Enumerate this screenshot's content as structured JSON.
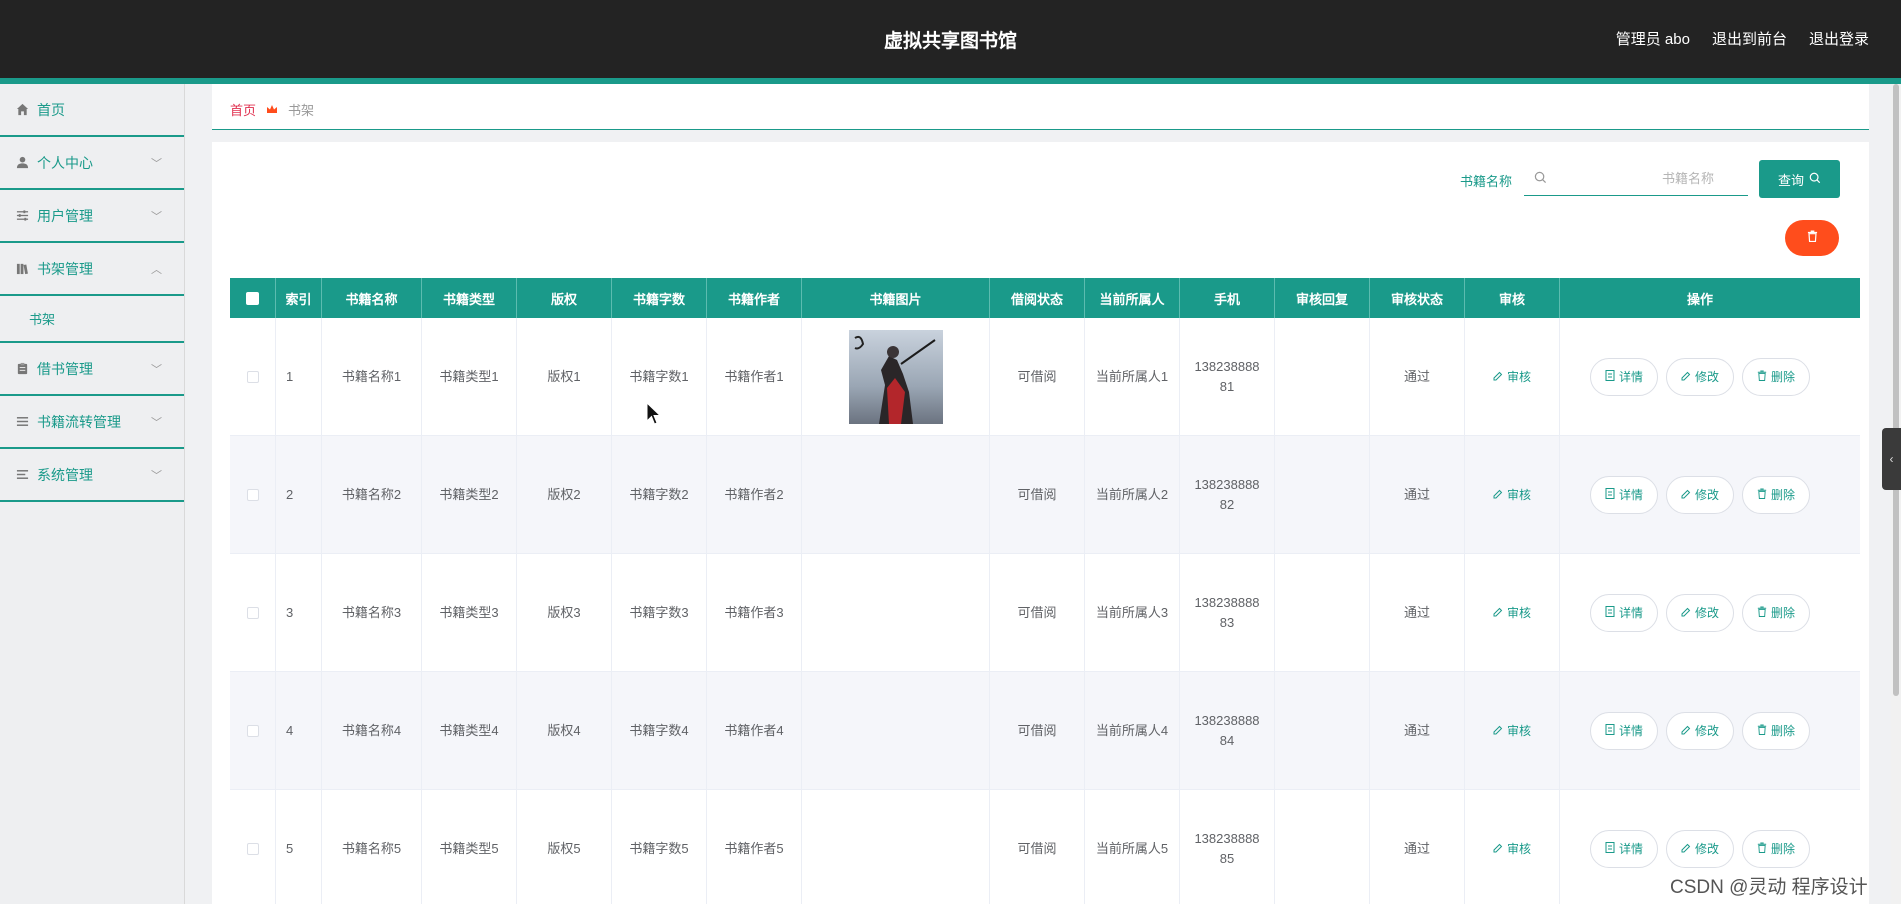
{
  "app": {
    "title": "虚拟共享图书馆",
    "user_label": "管理员 abo",
    "back_to_front": "退出到前台",
    "logout": "退出登录"
  },
  "sidebar": {
    "items": [
      {
        "label": "首页",
        "icon": "home-icon"
      },
      {
        "label": "个人中心",
        "icon": "user-icon"
      },
      {
        "label": "用户管理",
        "icon": "sliders-icon"
      },
      {
        "label": "书架管理",
        "icon": "books-icon"
      },
      {
        "label": "书架",
        "icon": ""
      },
      {
        "label": "借书管理",
        "icon": "clipboard-icon"
      },
      {
        "label": "书籍流转管理",
        "icon": "list-icon"
      },
      {
        "label": "系统管理",
        "icon": "menu-icon"
      }
    ]
  },
  "breadcrumb": {
    "home": "首页",
    "current": "书架"
  },
  "search": {
    "label": "书籍名称",
    "placeholder": "书籍名称",
    "button": "查询"
  },
  "table": {
    "headers": [
      "索引",
      "书籍名称",
      "书籍类型",
      "版权",
      "书籍字数",
      "书籍作者",
      "书籍图片",
      "借阅状态",
      "当前所属人",
      "手机",
      "审核回复",
      "审核状态",
      "审核",
      "操作"
    ],
    "rows": [
      {
        "index": "1",
        "name": "书籍名称1",
        "type": "书籍类型1",
        "copyright": "版权1",
        "words": "书籍字数1",
        "author": "书籍作者1",
        "borrow_status": "可借阅",
        "owner": "当前所属人1",
        "phone_line1": "138238888",
        "phone_line2": "81",
        "reply": "",
        "audit_status": "通过"
      },
      {
        "index": "2",
        "name": "书籍名称2",
        "type": "书籍类型2",
        "copyright": "版权2",
        "words": "书籍字数2",
        "author": "书籍作者2",
        "borrow_status": "可借阅",
        "owner": "当前所属人2",
        "phone_line1": "138238888",
        "phone_line2": "82",
        "reply": "",
        "audit_status": "通过"
      },
      {
        "index": "3",
        "name": "书籍名称3",
        "type": "书籍类型3",
        "copyright": "版权3",
        "words": "书籍字数3",
        "author": "书籍作者3",
        "borrow_status": "可借阅",
        "owner": "当前所属人3",
        "phone_line1": "138238888",
        "phone_line2": "83",
        "reply": "",
        "audit_status": "通过"
      },
      {
        "index": "4",
        "name": "书籍名称4",
        "type": "书籍类型4",
        "copyright": "版权4",
        "words": "书籍字数4",
        "author": "书籍作者4",
        "borrow_status": "可借阅",
        "owner": "当前所属人4",
        "phone_line1": "138238888",
        "phone_line2": "84",
        "reply": "",
        "audit_status": "通过"
      },
      {
        "index": "5",
        "name": "书籍名称5",
        "type": "书籍类型5",
        "copyright": "版权5",
        "words": "书籍字数5",
        "author": "书籍作者5",
        "borrow_status": "可借阅",
        "owner": "当前所属人5",
        "phone_line1": "138238888",
        "phone_line2": "85",
        "reply": "",
        "audit_status": "通过"
      }
    ],
    "audit_link": "审核",
    "ops": {
      "detail": "详情",
      "edit": "修改",
      "delete": "删除"
    }
  },
  "watermark": "CSDN @灵动 程序设计",
  "colors": {
    "accent": "#1a9a8a",
    "danger": "#ff4d1c",
    "header_bg": "#232323",
    "crumb_home": "#e0304f"
  }
}
